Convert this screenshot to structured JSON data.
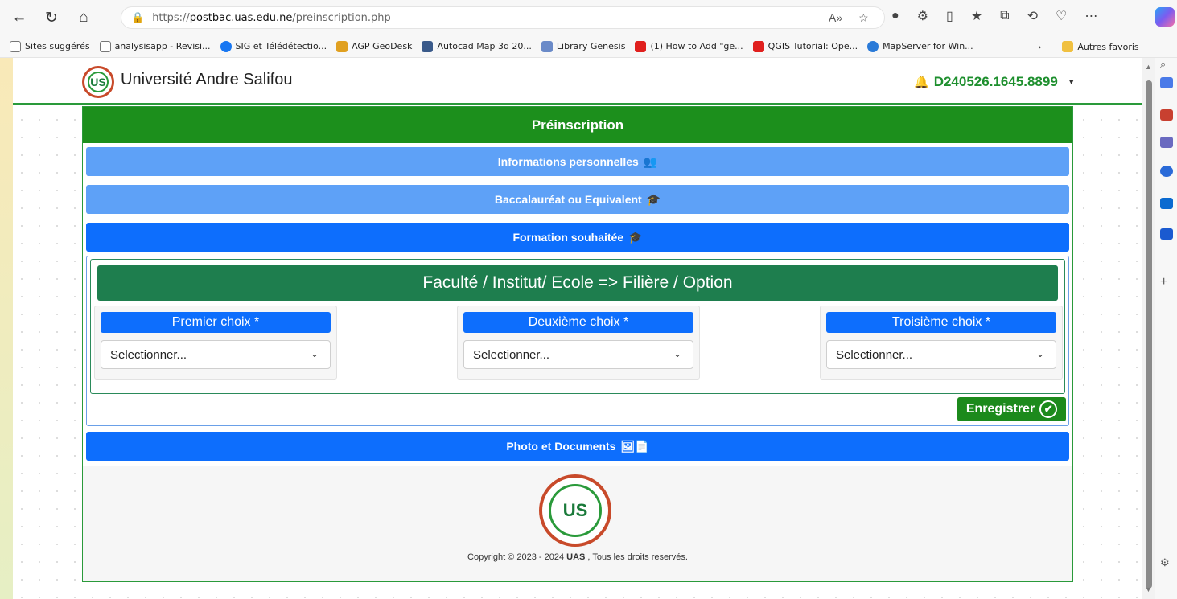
{
  "browser": {
    "url_prefix": "https://",
    "url_host": "postbac.uas.edu.ne",
    "url_path": "/preinscription.php",
    "bookmarks": [
      {
        "label": "Sites suggérés",
        "color": "#ffffff"
      },
      {
        "label": "analysisapp - Revisi...",
        "color": "#ffffff"
      },
      {
        "label": "SIG et Télédétectio...",
        "color": "#1877f2"
      },
      {
        "label": "AGP GeoDesk",
        "color": "#e0a020"
      },
      {
        "label": "Autocad Map 3d 20...",
        "color": "#3a5a8a"
      },
      {
        "label": "Library Genesis",
        "color": "#6a8ac8"
      },
      {
        "label": "(1) How to Add \"ge...",
        "color": "#e0201e"
      },
      {
        "label": "QGIS Tutorial: Ope...",
        "color": "#e0201e"
      },
      {
        "label": "MapServer for Win...",
        "color": "#2a7ad8"
      }
    ],
    "other_favorites": "Autres favoris"
  },
  "header": {
    "site_title": "Université Andre Salifou",
    "user_id": "D240526.1645.8899"
  },
  "card": {
    "title": "Préinscription",
    "sections": [
      {
        "label": "Informations personnelles",
        "icon": "👥"
      },
      {
        "label": "Baccalauréat ou Equivalent",
        "icon": "🎓"
      },
      {
        "label": "Formation souhaitée",
        "icon": "🎓"
      },
      {
        "label": "Photo et Documents",
        "icon": "🖼📄"
      }
    ],
    "formation_title": "Faculté / Institut/ Ecole => Filière / Option",
    "choices": [
      {
        "label": "Premier choix *",
        "value": "Selectionner..."
      },
      {
        "label": "Deuxième choix *",
        "value": "Selectionner..."
      },
      {
        "label": "Troisième choix *",
        "value": "Selectionner..."
      }
    ],
    "save_label": "Enregistrer"
  },
  "footer": {
    "logo_text": "US",
    "copyright_prefix": "Copyright © 2023 - 2024 ",
    "copyright_org": "UAS",
    "copyright_suffix": " , Tous les droits reservés."
  },
  "colors": {
    "primary_green": "#1c8f1c",
    "accent_blue": "#0d6efd",
    "light_blue": "#5ea1f7",
    "dark_green": "#1e7e4e"
  }
}
